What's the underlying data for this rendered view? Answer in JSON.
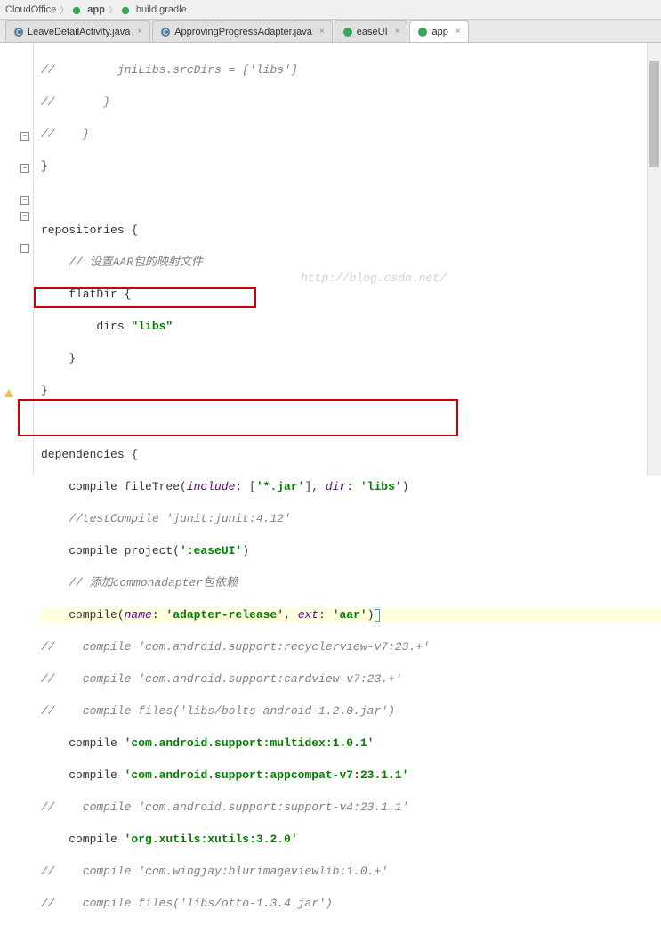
{
  "breadcrumb": {
    "items": [
      "CloudOffice",
      "app",
      "build.gradle"
    ],
    "app_icon": "app-icon"
  },
  "tabs": [
    {
      "label": "LeaveDetailActivity.java",
      "icon": "java",
      "active": false
    },
    {
      "label": "ApprovingProgressAdapter.java",
      "icon": "java",
      "active": false
    },
    {
      "label": "easeUI",
      "icon": "gradle",
      "active": false
    },
    {
      "label": "app",
      "icon": "gradle",
      "active": true
    }
  ],
  "watermark": "http://blog.csdn.net/",
  "code": {
    "l1": "//         jniLibs.srcDirs = ['libs']",
    "l2": "//       }",
    "l3": "//    }",
    "l4": "}",
    "l5": "",
    "l6": "repositories {",
    "l7_a": "    // ",
    "l7_b": "设置AAR包的映射文件",
    "l8": "    flatDir {",
    "l9a": "        dirs ",
    "l9b": "\"libs\"",
    "l10": "    }",
    "l11": "}",
    "l12": "",
    "l13": "dependencies {",
    "l14a": "    compile fileTree(",
    "l14b": "include",
    "l14c": ": [",
    "l14d": "'*.jar'",
    "l14e": "], ",
    "l14f": "dir",
    "l14g": ": ",
    "l14h": "'libs'",
    "l14i": ")",
    "l15": "    //testCompile 'junit:junit:4.12'",
    "l16a": "    compile project(",
    "l16b": "':easeUI'",
    "l16c": ")",
    "l17a": "    // ",
    "l17b": "添加commonadapter包依赖",
    "l18a": "    compile(",
    "l18b": "name",
    "l18c": ": ",
    "l18d": "'adapter-release'",
    "l18e": ", ",
    "l18f": "ext",
    "l18g": ": ",
    "l18h": "'aar'",
    "l18i": ")",
    "l19": "//    compile 'com.android.support:recyclerview-v7:23.+'",
    "l20": "//    compile 'com.android.support:cardview-v7:23.+'",
    "l21": "//    compile files('libs/bolts-android-1.2.0.jar')",
    "l22a": "    compile ",
    "l22b": "'com.android.support:multidex:1.0.1'",
    "l23a": "    compile ",
    "l23b": "'com.android.support:appcompat-v7:23.1.1'",
    "l24": "//    compile 'com.android.support:support-v4:23.1.1'",
    "l25a": "    compile ",
    "l25b": "'org.xutils:xutils:3.2.0'",
    "l26": "//    compile 'com.wingjay:blurimageviewlib:1.0.+'",
    "l27": "//    compile files('libs/otto-1.3.4.jar')"
  }
}
